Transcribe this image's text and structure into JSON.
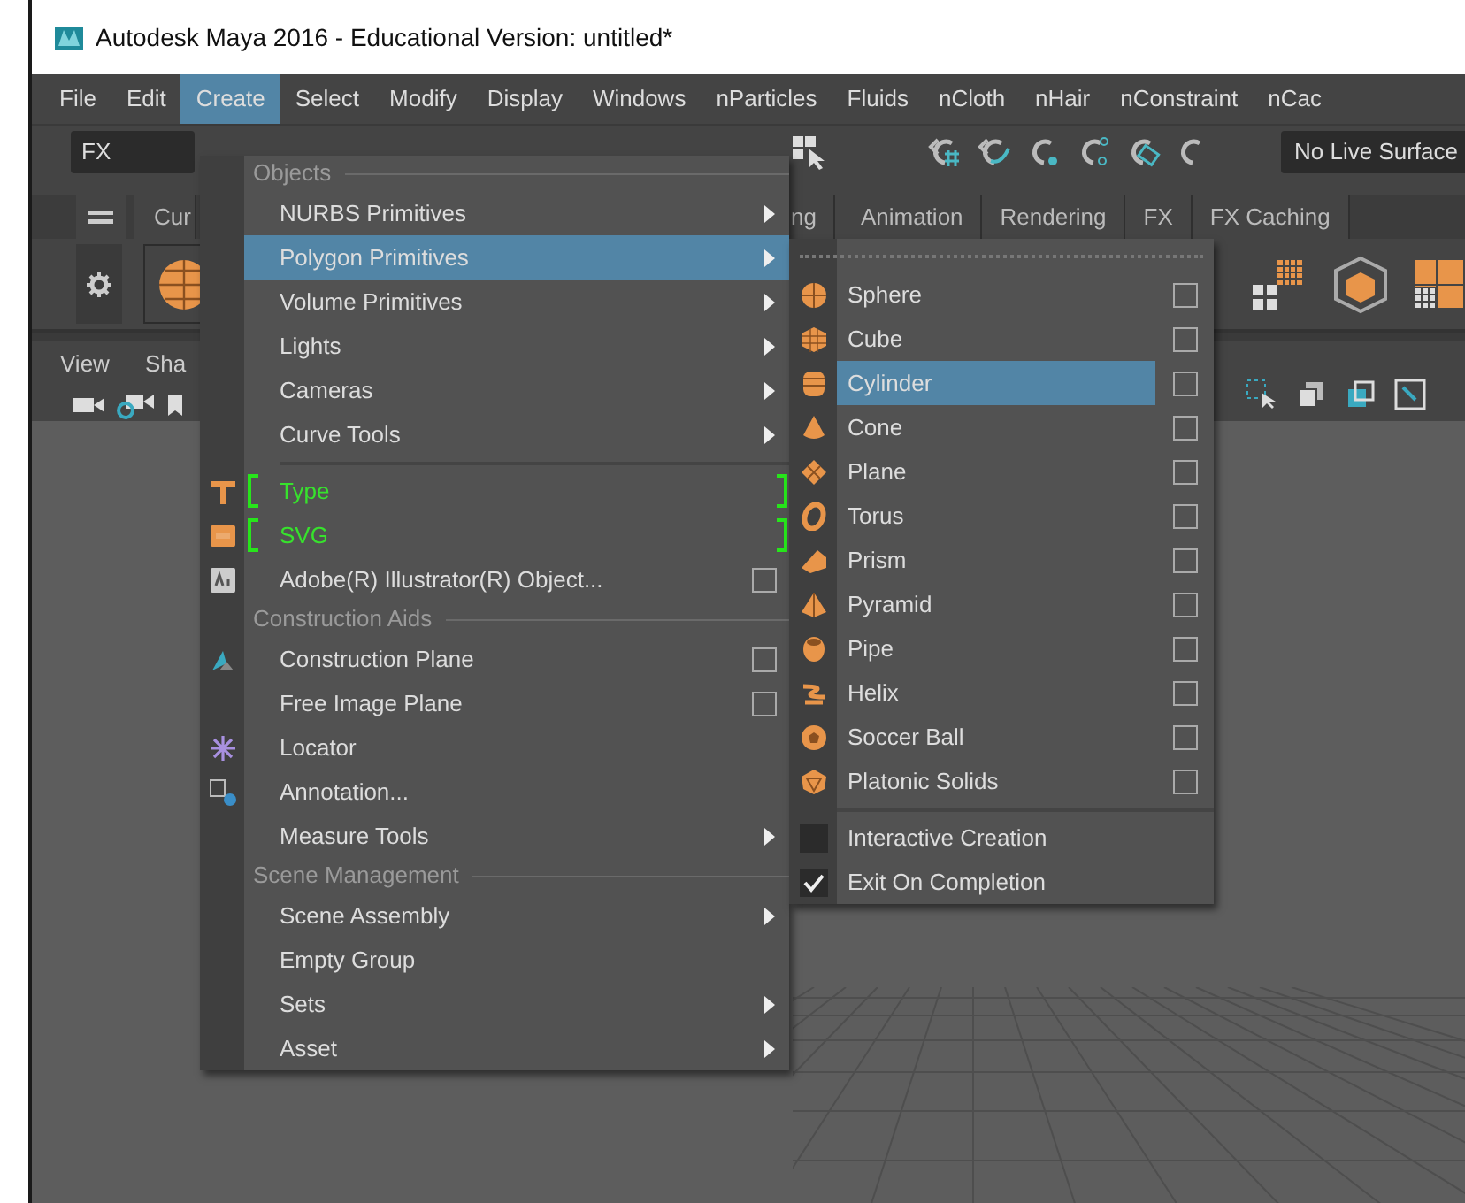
{
  "window": {
    "title": "Autodesk Maya 2016 - Educational Version: untitled*"
  },
  "menubar": [
    {
      "label": "File",
      "selected": false
    },
    {
      "label": "Edit",
      "selected": false
    },
    {
      "label": "Create",
      "selected": true
    },
    {
      "label": "Select",
      "selected": false
    },
    {
      "label": "Modify",
      "selected": false
    },
    {
      "label": "Display",
      "selected": false
    },
    {
      "label": "Windows",
      "selected": false
    },
    {
      "label": "nParticles",
      "selected": false
    },
    {
      "label": "Fluids",
      "selected": false
    },
    {
      "label": "nCloth",
      "selected": false
    },
    {
      "label": "nHair",
      "selected": false
    },
    {
      "label": "nConstraint",
      "selected": false
    },
    {
      "label": "nCac",
      "selected": false
    }
  ],
  "toolbar": {
    "menu_set": "FX",
    "live_surface": "No Live Surface"
  },
  "shelf_tabs": [
    "Cur",
    "ng",
    "Animation",
    "Rendering",
    "FX",
    "FX Caching"
  ],
  "viewport": {
    "menus": [
      "View",
      "Sha"
    ]
  },
  "create_menu": [
    {
      "kind": "header",
      "label": "Objects"
    },
    {
      "kind": "submenu",
      "label": "NURBS Primitives",
      "selected": false
    },
    {
      "kind": "submenu",
      "label": "Polygon Primitives",
      "selected": true
    },
    {
      "kind": "submenu",
      "label": "Volume Primitives",
      "selected": false
    },
    {
      "kind": "submenu",
      "label": "Lights",
      "selected": false
    },
    {
      "kind": "submenu",
      "label": "Cameras",
      "selected": false
    },
    {
      "kind": "submenu",
      "label": "Curve Tools",
      "selected": false
    },
    {
      "kind": "separator"
    },
    {
      "kind": "new",
      "label": "Type",
      "selected": false
    },
    {
      "kind": "new",
      "label": "SVG",
      "selected": false
    },
    {
      "kind": "action",
      "label": "Adobe(R) Illustrator(R) Object...",
      "selected": false,
      "option_box": true
    },
    {
      "kind": "header",
      "label": "Construction Aids"
    },
    {
      "kind": "action",
      "label": "Construction Plane",
      "selected": false,
      "option_box": true
    },
    {
      "kind": "action",
      "label": "Free Image Plane",
      "selected": false,
      "option_box": true
    },
    {
      "kind": "action",
      "label": "Locator",
      "selected": false,
      "option_box": false
    },
    {
      "kind": "action",
      "label": "Annotation...",
      "selected": false,
      "option_box": false
    },
    {
      "kind": "submenu",
      "label": "Measure Tools",
      "selected": false
    },
    {
      "kind": "header",
      "label": "Scene Management"
    },
    {
      "kind": "submenu",
      "label": "Scene Assembly",
      "selected": false
    },
    {
      "kind": "action",
      "label": "Empty Group",
      "selected": false,
      "option_box": false
    },
    {
      "kind": "submenu",
      "label": "Sets",
      "selected": false
    },
    {
      "kind": "submenu",
      "label": "Asset",
      "selected": false
    }
  ],
  "polygon_submenu": [
    {
      "kind": "action",
      "label": "Sphere",
      "selected": false,
      "option_box": true
    },
    {
      "kind": "action",
      "label": "Cube",
      "selected": false,
      "option_box": true
    },
    {
      "kind": "action",
      "label": "Cylinder",
      "selected": true,
      "option_box": true
    },
    {
      "kind": "action",
      "label": "Cone",
      "selected": false,
      "option_box": true
    },
    {
      "kind": "action",
      "label": "Plane",
      "selected": false,
      "option_box": true
    },
    {
      "kind": "action",
      "label": "Torus",
      "selected": false,
      "option_box": true
    },
    {
      "kind": "action",
      "label": "Prism",
      "selected": false,
      "option_box": true
    },
    {
      "kind": "action",
      "label": "Pyramid",
      "selected": false,
      "option_box": true
    },
    {
      "kind": "action",
      "label": "Pipe",
      "selected": false,
      "option_box": true
    },
    {
      "kind": "action",
      "label": "Helix",
      "selected": false,
      "option_box": true
    },
    {
      "kind": "action",
      "label": "Soccer Ball",
      "selected": false,
      "option_box": true
    },
    {
      "kind": "action",
      "label": "Platonic Solids",
      "selected": false,
      "option_box": true
    },
    {
      "kind": "separator"
    },
    {
      "kind": "toggle",
      "label": "Interactive Creation",
      "selected": false,
      "checked": false
    },
    {
      "kind": "toggle",
      "label": "Exit On Completion",
      "selected": false,
      "checked": true
    }
  ]
}
